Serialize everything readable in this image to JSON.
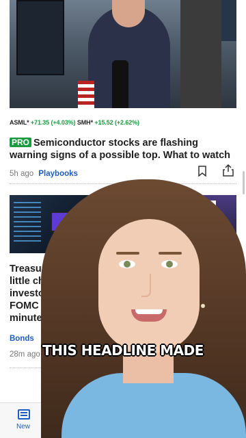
{
  "feed": {
    "tickers": [
      {
        "symbol": "ASML*",
        "change": "+71.35 (+4.03%)"
      },
      {
        "symbol": "SMH*",
        "change": "+15.52 (+2.62%)"
      }
    ],
    "article1": {
      "badge": "PRO",
      "headline": "Semiconductor stocks are flashing warning signs of a possible top. What to watch",
      "time": "5h ago",
      "category": "Playbooks"
    },
    "article2": {
      "headline": "Treasury yields are little changed as investors look ahea to FOMC meeting minutes",
      "category": "Bonds",
      "time": "28m ago"
    }
  },
  "tabbar": {
    "active_label": "New"
  },
  "video_overlay": {
    "caption": "THIS HEADLINE MADE"
  },
  "colors": {
    "accent_blue": "#1d5bc0",
    "positive_green": "#1b9a3f"
  },
  "icons": [
    "bookmark-icon",
    "share-icon",
    "news-tab-icon"
  ]
}
